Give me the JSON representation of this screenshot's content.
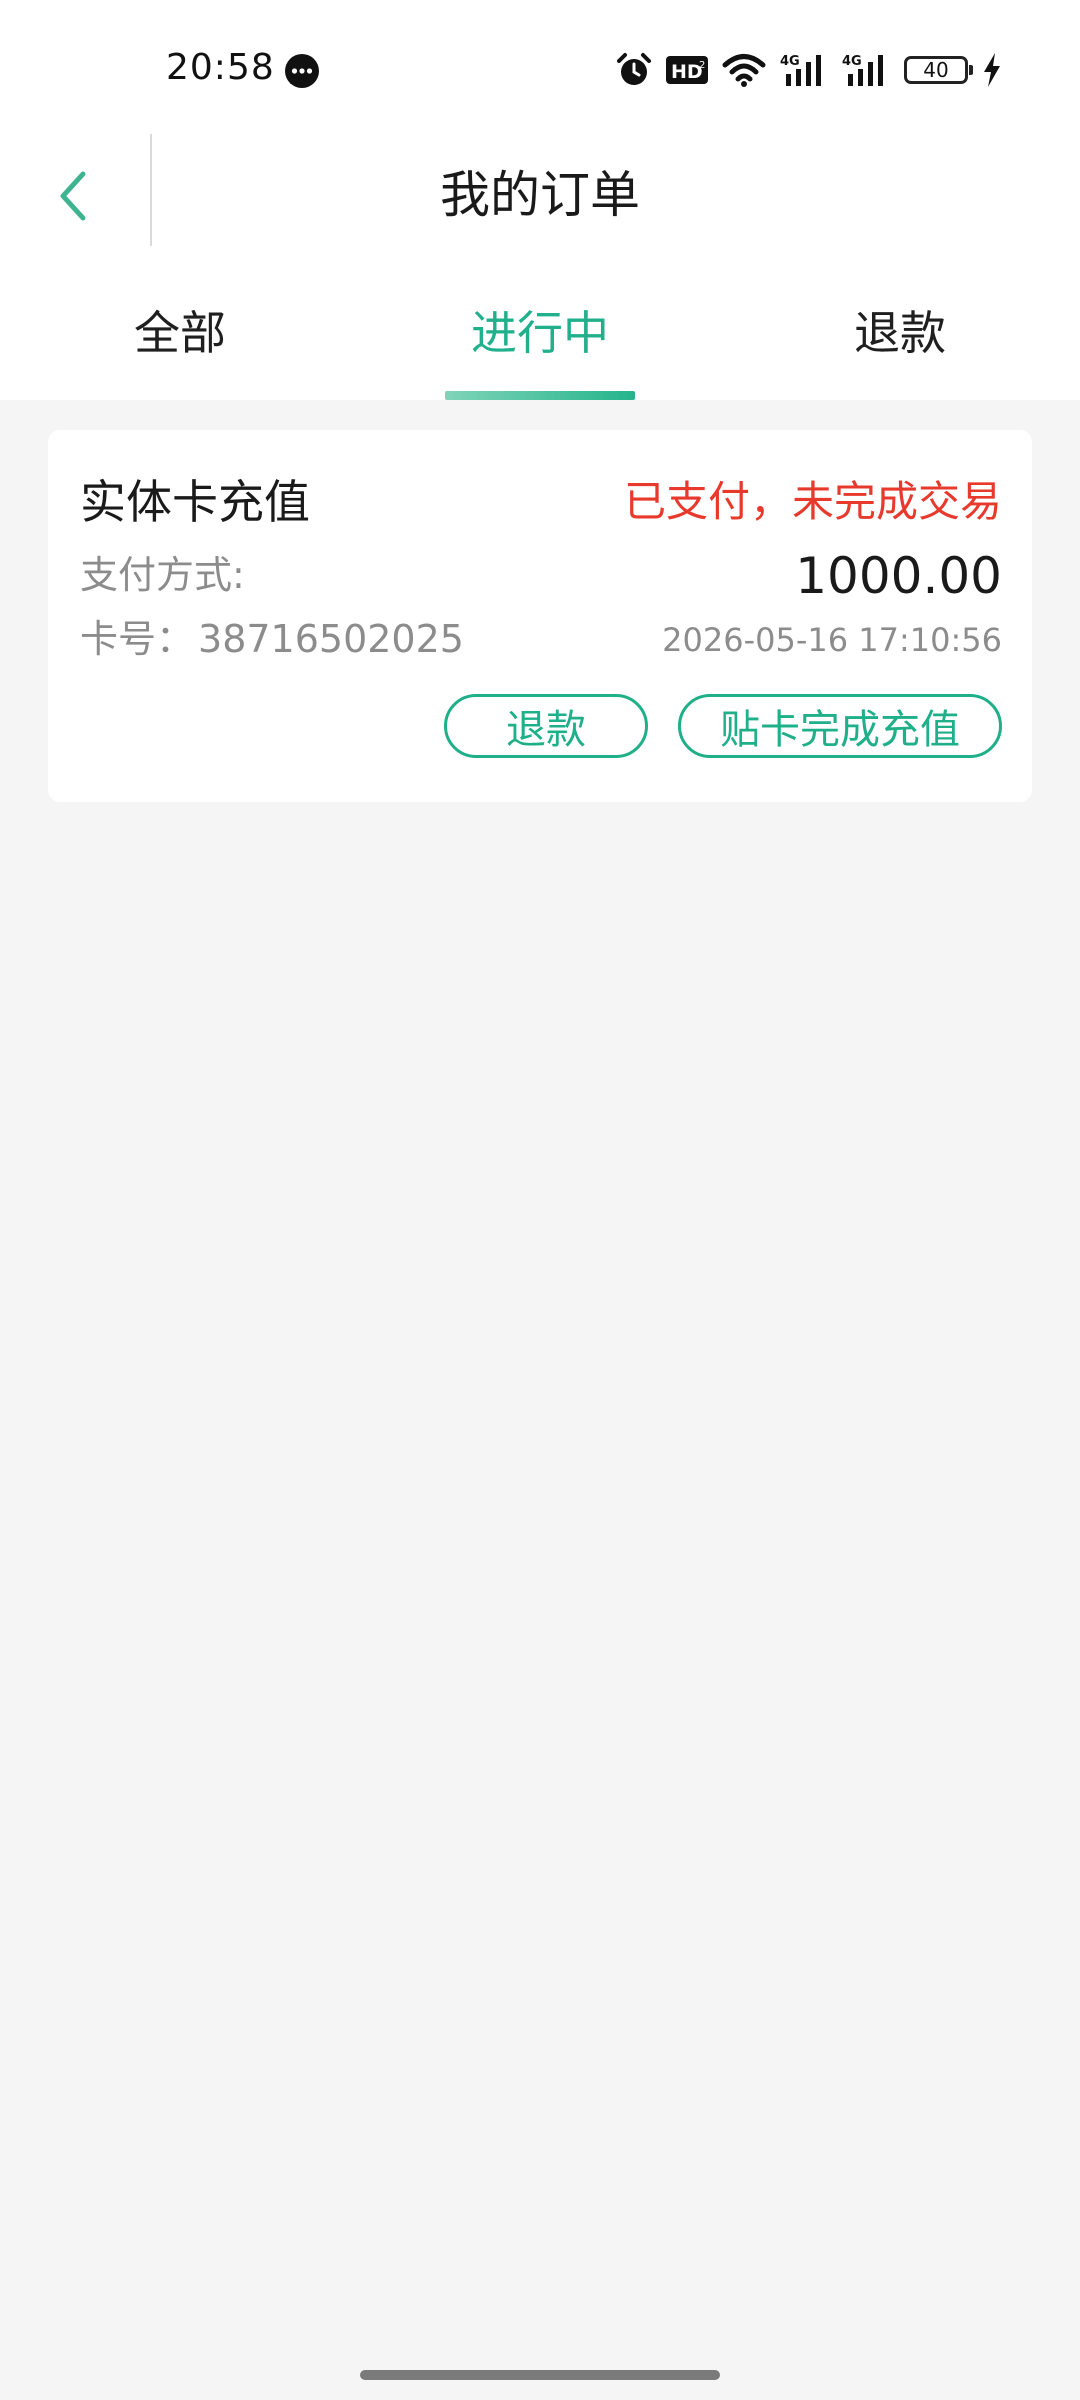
{
  "status_bar": {
    "time": "20:58",
    "battery": "40",
    "icons": [
      "message-icon",
      "alarm-icon",
      "hd-icon",
      "wifi-icon",
      "signal-4g-icon",
      "signal-4g-icon",
      "battery-icon",
      "charging-icon"
    ]
  },
  "header": {
    "title": "我的订单",
    "back_icon": "chevron-left-icon"
  },
  "tabs": [
    {
      "label": "全部",
      "selected": false
    },
    {
      "label": "进行中",
      "selected": true
    },
    {
      "label": "退款",
      "selected": false
    }
  ],
  "orders": [
    {
      "name": "实体卡充值",
      "status": "已支付，未完成交易",
      "pay_method_label": "支付方式:",
      "amount": "1000.00",
      "card_no_label": "卡号：",
      "card_no": "38716502025",
      "time": "2026-05-16 17:10:56",
      "actions": [
        "退款",
        "贴卡完成充值"
      ]
    }
  ],
  "colors": {
    "accent": "#20b08c",
    "status_red": "#e8392d",
    "background": "#f5f5f5",
    "muted_text": "#8c8c8c"
  }
}
